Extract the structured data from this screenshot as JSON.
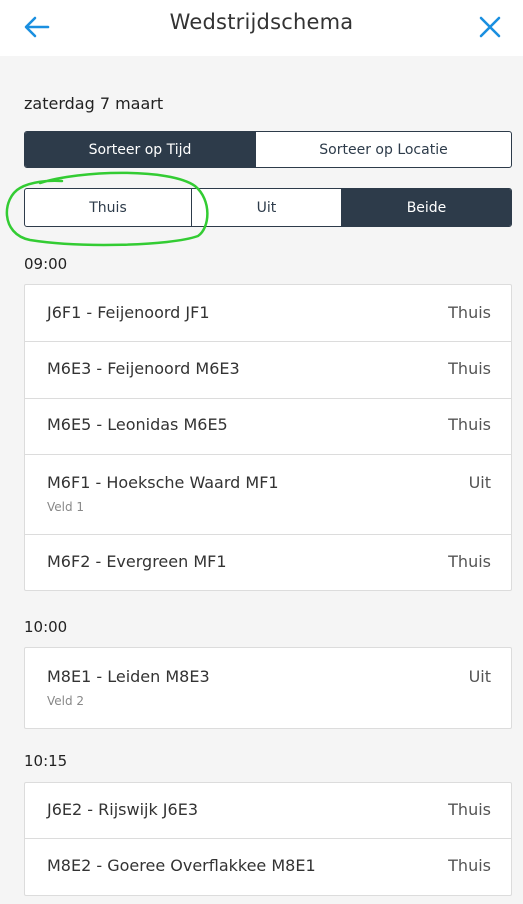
{
  "header": {
    "title": "Wedstrijdschema"
  },
  "date": "zaterdag 7 maart",
  "sort_toggle": [
    "Sorteer op Tijd",
    "Sorteer op Locatie"
  ],
  "filter_toggle": [
    "Thuis",
    "Uit",
    "Beide"
  ],
  "groups": [
    {
      "time": "09:00",
      "matches": [
        {
          "name": "J6F1 - Feijenoord JF1",
          "location": "Thuis"
        },
        {
          "name": "M6E3 - Feijenoord M6E3",
          "location": "Thuis"
        },
        {
          "name": "M6E5 - Leonidas M6E5",
          "location": "Thuis"
        },
        {
          "name": "M6F1 - Hoeksche Waard MF1",
          "location": "Uit",
          "field": "Veld 1"
        },
        {
          "name": "M6F2 - Evergreen MF1",
          "location": "Thuis"
        }
      ]
    },
    {
      "time": "10:00",
      "matches": [
        {
          "name": "M8E1 - Leiden M8E3",
          "location": "Uit",
          "field": "Veld 2"
        }
      ]
    },
    {
      "time": "10:15",
      "matches": [
        {
          "name": "J6E2 - Rijswijk J6E3",
          "location": "Thuis"
        },
        {
          "name": "M8E2 - Goeree Overflakkee M8E1",
          "location": "Thuis"
        }
      ]
    }
  ],
  "colors": {
    "accent": "#1a8fe0",
    "active": "#2d3b4a",
    "annotation": "#33cc33"
  }
}
